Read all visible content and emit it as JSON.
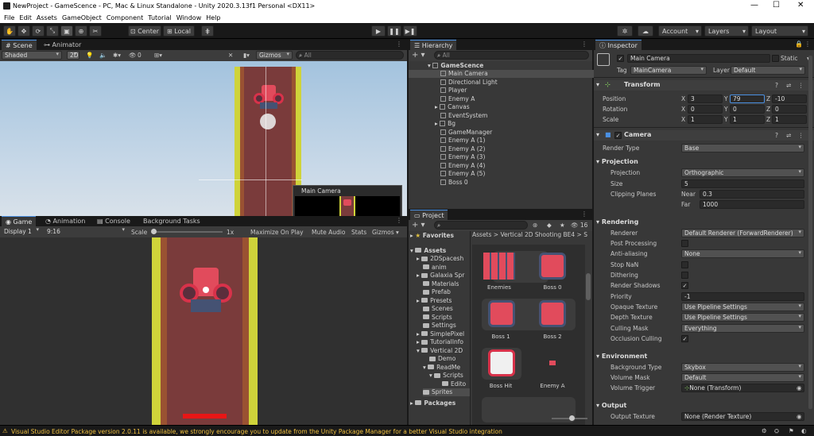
{
  "window": {
    "title": "NewProject - GameScence - PC, Mac & Linux Standalone - Unity 2020.3.13f1 Personal <DX11>"
  },
  "menu": [
    "File",
    "Edit",
    "Assets",
    "GameObject",
    "Component",
    "Tutorial",
    "Window",
    "Help"
  ],
  "toolbar": {
    "pivot": "Center",
    "space": "Local",
    "account": "Account",
    "layers": "Layers",
    "layout": "Layout"
  },
  "scene": {
    "tabs": [
      "Scene",
      "Animator"
    ],
    "shading": "Shaded",
    "mode2d": "2D",
    "hidden_count": "0",
    "gizmos": "Gizmos",
    "search_placeholder": "All",
    "camera_preview_title": "Main Camera"
  },
  "game": {
    "tabs": [
      "Game",
      "Animation",
      "Console",
      "Background Tasks"
    ],
    "display": "Display 1",
    "aspect": "9:16",
    "scale_label": "Scale",
    "scale_value": "1x",
    "maximize": "Maximize On Play",
    "mute": "Mute Audio",
    "stats": "Stats",
    "gizmos": "Gizmos"
  },
  "hierarchy": {
    "title": "Hierarchy",
    "search_placeholder": "All",
    "root": "GameScence",
    "items": [
      "Main Camera",
      "Directional Light",
      "Player",
      "Enemy A",
      "Canvas",
      "EventSystem",
      "Bg",
      "GameManager",
      "Enemy A (1)",
      "Enemy A (2)",
      "Enemy A (3)",
      "Enemy A (4)",
      "Enemy A (5)",
      "Boss 0"
    ]
  },
  "project": {
    "title": "Project",
    "hidden_count": "16",
    "favorites": "Favorites",
    "assets": "Assets",
    "tree": [
      "2DSpacesh",
      "anim",
      "Galaxia Spr",
      "Materials",
      "Prefab",
      "Presets",
      "Scenes",
      "Scripts",
      "Settings",
      "SimplePixel",
      "TutorialInfo",
      "Vertical 2D",
      "Demo",
      "ReadMe",
      "Scripts",
      "Edito",
      "Sprites"
    ],
    "packages": "Packages",
    "breadcrumb": [
      "Assets",
      "Vertical 2D Shooting BE4",
      "S"
    ],
    "grid": [
      "Enemies",
      "Boss 0",
      "Boss 1",
      "Boss 2",
      "Boss Hit",
      "Enemy A"
    ]
  },
  "inspector": {
    "title": "Inspector",
    "object_name": "Main Camera",
    "static": "Static",
    "tag_label": "Tag",
    "tag": "MainCamera",
    "layer_label": "Layer",
    "layer": "Default",
    "transform": {
      "title": "Transform",
      "position_label": "Position",
      "position": [
        "3",
        "79",
        "-10"
      ],
      "rotation_label": "Rotation",
      "rotation": [
        "0",
        "0",
        "0"
      ],
      "scale_label": "Scale",
      "scale": [
        "1",
        "1",
        "1"
      ],
      "axes": [
        "X",
        "Y",
        "Z"
      ]
    },
    "camera": {
      "title": "Camera",
      "render_type_label": "Render Type",
      "render_type": "Base",
      "projection_header": "Projection",
      "projection_label": "Projection",
      "projection": "Orthographic",
      "size_label": "Size",
      "size": "5",
      "clipping_label": "Clipping Planes",
      "near_label": "Near",
      "near": "0.3",
      "far_label": "Far",
      "far": "1000",
      "rendering_header": "Rendering",
      "renderer_label": "Renderer",
      "renderer": "Default Renderer (ForwardRenderer)",
      "post_label": "Post Processing",
      "aa_label": "Anti-aliasing",
      "aa": "None",
      "stopnan_label": "Stop NaN",
      "dither_label": "Dithering",
      "shadows_label": "Render Shadows",
      "priority_label": "Priority",
      "priority": "-1",
      "opaque_label": "Opaque Texture",
      "opaque": "Use Pipeline Settings",
      "depth_label": "Depth Texture",
      "depth": "Use Pipeline Settings",
      "culling_label": "Culling Mask",
      "culling": "Everything",
      "occlusion_label": "Occlusion Culling",
      "environment_header": "Environment",
      "bg_label": "Background Type",
      "bg": "Skybox",
      "volmask_label": "Volume Mask",
      "volmask": "Default",
      "voltrig_label": "Volume Trigger",
      "voltrig": "None (Transform)",
      "output_header": "Output",
      "outtex_label": "Output Texture",
      "outtex": "None (Render Texture)"
    }
  },
  "status": {
    "message": "Visual Studio Editor Package version 2.0.11 is available, we strongly encourage you to update from the Unity Package Manager for a better Visual Studio integration"
  }
}
